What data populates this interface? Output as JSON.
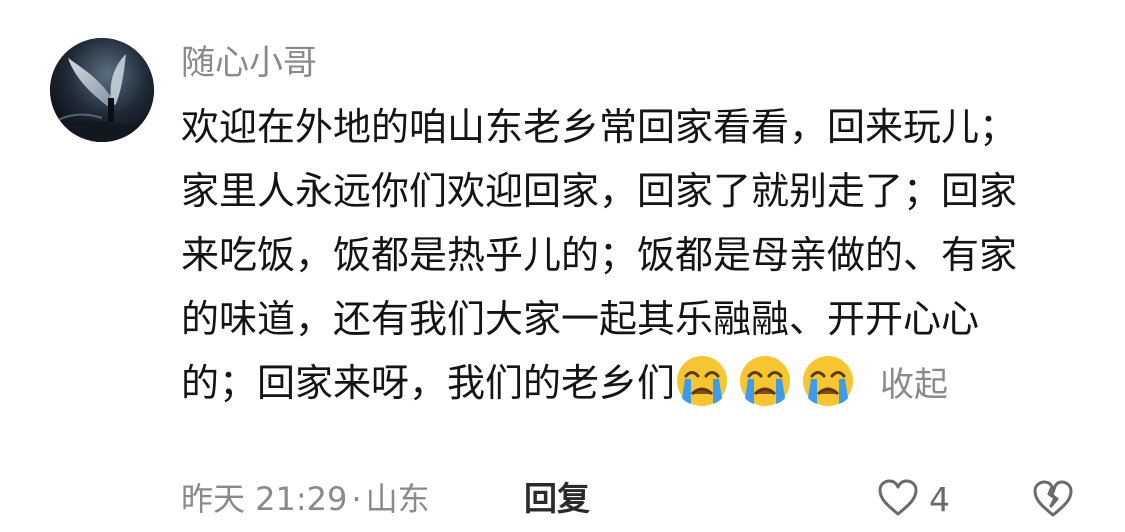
{
  "comment": {
    "username": "随心小哥",
    "text": "欢迎在外地的咱山东老乡常回家看看，回来玩儿；家里人永远你们欢迎回家，回家了就别走了；回家来吃饭，饭都是热乎儿的；饭都是母亲做的、有家的味道，还有我们大家一起其乐融融、开开心心的；回家来呀，我们的老乡们",
    "emojis": [
      "crying-face-emoji",
      "crying-face-emoji",
      "crying-face-emoji"
    ],
    "collapse_label": "收起",
    "time": "昨天 21:29",
    "separator": "·",
    "location": "山东",
    "reply_label": "回复",
    "like_count": "4",
    "icons": {
      "like": "heart-outline-icon",
      "dislike": "broken-heart-outline-icon"
    }
  },
  "colors": {
    "text": "#141414",
    "secondary": "#8a8a8a",
    "emoji_face": "#f7c531",
    "tears": "#3f9be8"
  }
}
